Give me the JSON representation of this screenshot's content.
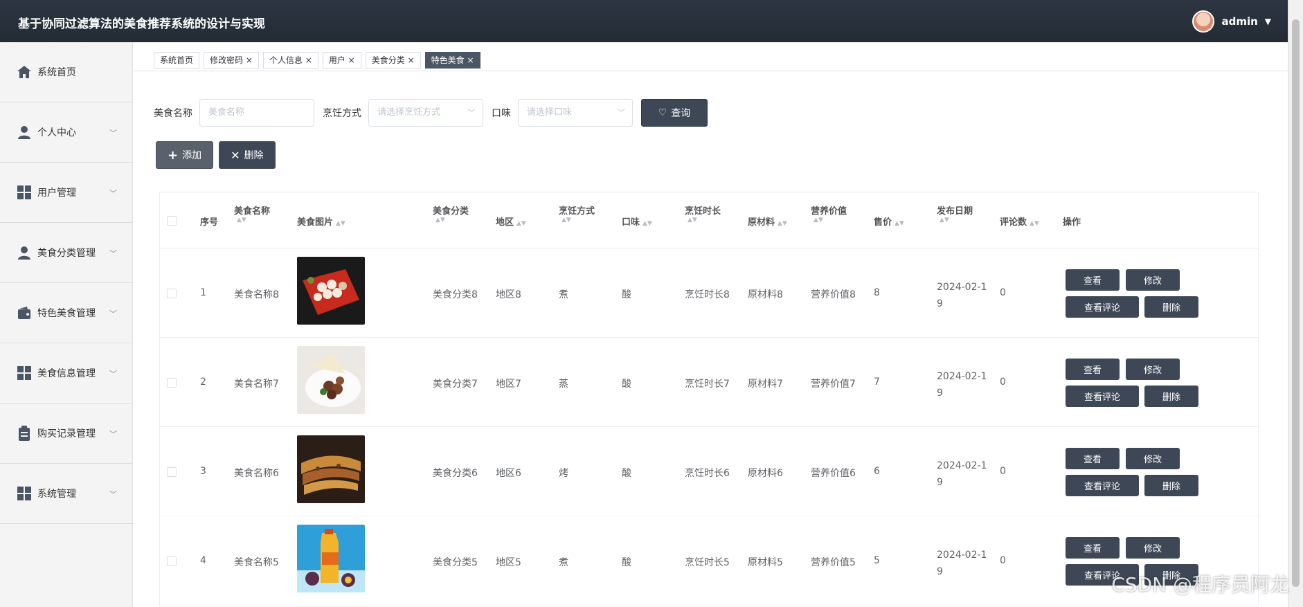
{
  "header": {
    "title": "基于协同过滤算法的美食推荐系统的设计与实现",
    "user": "admin"
  },
  "sidebar": {
    "items": [
      {
        "label": "系统首页",
        "icon": "home-icon"
      },
      {
        "label": "个人中心",
        "icon": "user-icon"
      },
      {
        "label": "用户管理",
        "icon": "grid-icon"
      },
      {
        "label": "美食分类管理",
        "icon": "user-icon"
      },
      {
        "label": "特色美食管理",
        "icon": "wallet-icon"
      },
      {
        "label": "美食信息管理",
        "icon": "grid-icon"
      },
      {
        "label": "购买记录管理",
        "icon": "clipboard-icon"
      },
      {
        "label": "系统管理",
        "icon": "grid-icon"
      }
    ]
  },
  "tabs": [
    "系统首页",
    "修改密码",
    "个人信息",
    "用户",
    "美食分类",
    "特色美食"
  ],
  "search": {
    "name_label": "美食名称",
    "name_placeholder": "美食名称",
    "method_label": "烹饪方式",
    "method_placeholder": "请选择烹饪方式",
    "taste_label": "口味",
    "taste_placeholder": "请选择口味",
    "query_button": "查询"
  },
  "toolbar": {
    "add": "添加",
    "delete": "删除"
  },
  "table": {
    "columns": [
      "序号",
      "美食名称",
      "美食图片",
      "美食分类",
      "地区",
      "烹饪方式",
      "口味",
      "烹饪时长",
      "原材料",
      "营养价值",
      "售价",
      "发布日期",
      "评论数",
      "操作"
    ],
    "rows": [
      {
        "index": "1",
        "name": "美食名称8",
        "category": "美食分类8",
        "region": "地区8",
        "method": "煮",
        "taste": "酸",
        "duration": "烹饪时长8",
        "material": "原材料8",
        "nutrition": "营养价值8",
        "price": "8",
        "date_a": "2024-02-1",
        "date_b": "9",
        "comments": "0"
      },
      {
        "index": "2",
        "name": "美食名称7",
        "category": "美食分类7",
        "region": "地区7",
        "method": "蒸",
        "taste": "酸",
        "duration": "烹饪时长7",
        "material": "原材料7",
        "nutrition": "营养价值7",
        "price": "7",
        "date_a": "2024-02-1",
        "date_b": "9",
        "comments": "0"
      },
      {
        "index": "3",
        "name": "美食名称6",
        "category": "美食分类6",
        "region": "地区6",
        "method": "烤",
        "taste": "酸",
        "duration": "烹饪时长6",
        "material": "原材料6",
        "nutrition": "营养价值6",
        "price": "6",
        "date_a": "2024-02-1",
        "date_b": "9",
        "comments": "0"
      },
      {
        "index": "4",
        "name": "美食名称5",
        "category": "美食分类5",
        "region": "地区5",
        "method": "煮",
        "taste": "酸",
        "duration": "烹饪时长5",
        "material": "原材料5",
        "nutrition": "营养价值5",
        "price": "5",
        "date_a": "2024-02-1",
        "date_b": "9",
        "comments": "0"
      }
    ],
    "ops": {
      "view": "查看",
      "edit": "修改",
      "comments": "查看评论",
      "delete": "删除"
    }
  },
  "watermark": "CSDN @程序员阿龙"
}
